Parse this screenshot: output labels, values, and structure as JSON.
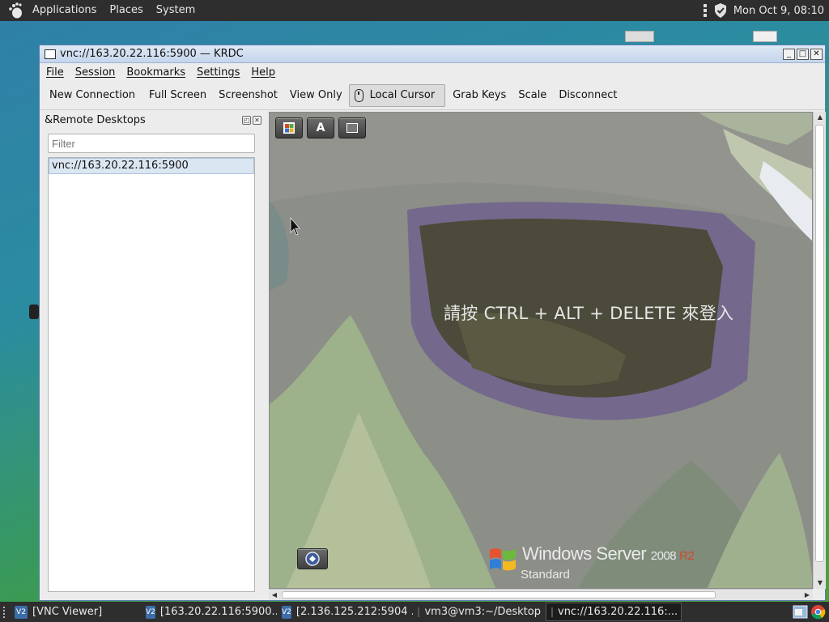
{
  "top_panel": {
    "menus": [
      "Applications",
      "Places",
      "System"
    ],
    "clock": "Mon Oct  9, 08:10"
  },
  "window": {
    "title": "vnc://163.20.22.116:5900 — KRDC",
    "controls": [
      "minimize",
      "maximize",
      "close"
    ]
  },
  "menubar": {
    "file_u": "F",
    "file_rest": "ile",
    "session_u": "S",
    "session_rest": "ession",
    "bookmarks_u": "B",
    "bookmarks_rest": "ookmarks",
    "settings_u": "S",
    "settings_rest": "ettings",
    "help_u": "H",
    "help_rest": "elp"
  },
  "toolbar": {
    "new_connection": "New Connection",
    "full_screen": "Full Screen",
    "screenshot": "Screenshot",
    "view_only": "View Only",
    "local_cursor": "Local Cursor",
    "grab_keys": "Grab Keys",
    "scale": "Scale",
    "disconnect": "Disconnect"
  },
  "side_panel": {
    "title": "&Remote Desktops",
    "filter_placeholder": "Filter",
    "connections": [
      "vnc://163.20.22.116:5900"
    ]
  },
  "remote": {
    "buttons": [
      "windows-key-icon",
      "text-a-icon",
      "square-icon"
    ],
    "login_message": "請按 CTRL + ALT + DELETE 來登入",
    "product_name": "Windows Server",
    "product_version": "2008",
    "product_release": "R2",
    "edition": "Standard",
    "colors": {
      "background": "#8a8d86",
      "mask_dark": "#4a4a3a",
      "mask_purple": "#6c5c8e",
      "stream_light": "#a9ba93"
    }
  },
  "taskbar": {
    "tasks": [
      {
        "label": "[VNC Viewer]",
        "icon": "vnc-icon",
        "active": false
      },
      {
        "label": "[163.20.22.116:5900...",
        "icon": "vnc-icon",
        "active": false
      },
      {
        "label": "[2.136.125.212:5904 ...",
        "icon": "vnc-icon",
        "active": false
      },
      {
        "label": "vm3@vm3:~/Desktop",
        "icon": "terminal-icon",
        "active": false
      },
      {
        "label": "vnc://163.20.22.116:...",
        "icon": "window-icon",
        "active": true
      }
    ]
  }
}
